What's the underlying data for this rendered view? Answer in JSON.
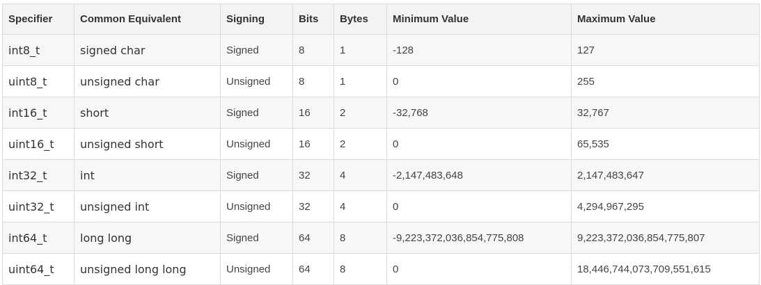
{
  "table": {
    "headers": [
      "Specifier",
      "Common Equivalent",
      "Signing",
      "Bits",
      "Bytes",
      "Minimum Value",
      "Maximum Value"
    ],
    "rows": [
      [
        "int8_t",
        "signed char",
        "Signed",
        "8",
        "1",
        "-128",
        "127"
      ],
      [
        "uint8_t",
        "unsigned char",
        "Unsigned",
        "8",
        "1",
        "0",
        "255"
      ],
      [
        "int16_t",
        "short",
        "Signed",
        "16",
        "2",
        "-32,768",
        "32,767"
      ],
      [
        "uint16_t",
        "unsigned short",
        "Unsigned",
        "16",
        "2",
        "0",
        "65,535"
      ],
      [
        "int32_t",
        "int",
        "Signed",
        "32",
        "4",
        "-2,147,483,648",
        "2,147,483,647"
      ],
      [
        "uint32_t",
        "unsigned int",
        "Unsigned",
        "32",
        "4",
        "0",
        "4,294,967,295"
      ],
      [
        "int64_t",
        "long long",
        "Signed",
        "64",
        "8",
        "-9,223,372,036,854,775,808",
        "9,223,372,036,854,775,807"
      ],
      [
        "uint64_t",
        "unsigned long long",
        "Unsigned",
        "64",
        "8",
        "0",
        "18,446,744,073,709,551,615"
      ]
    ]
  }
}
